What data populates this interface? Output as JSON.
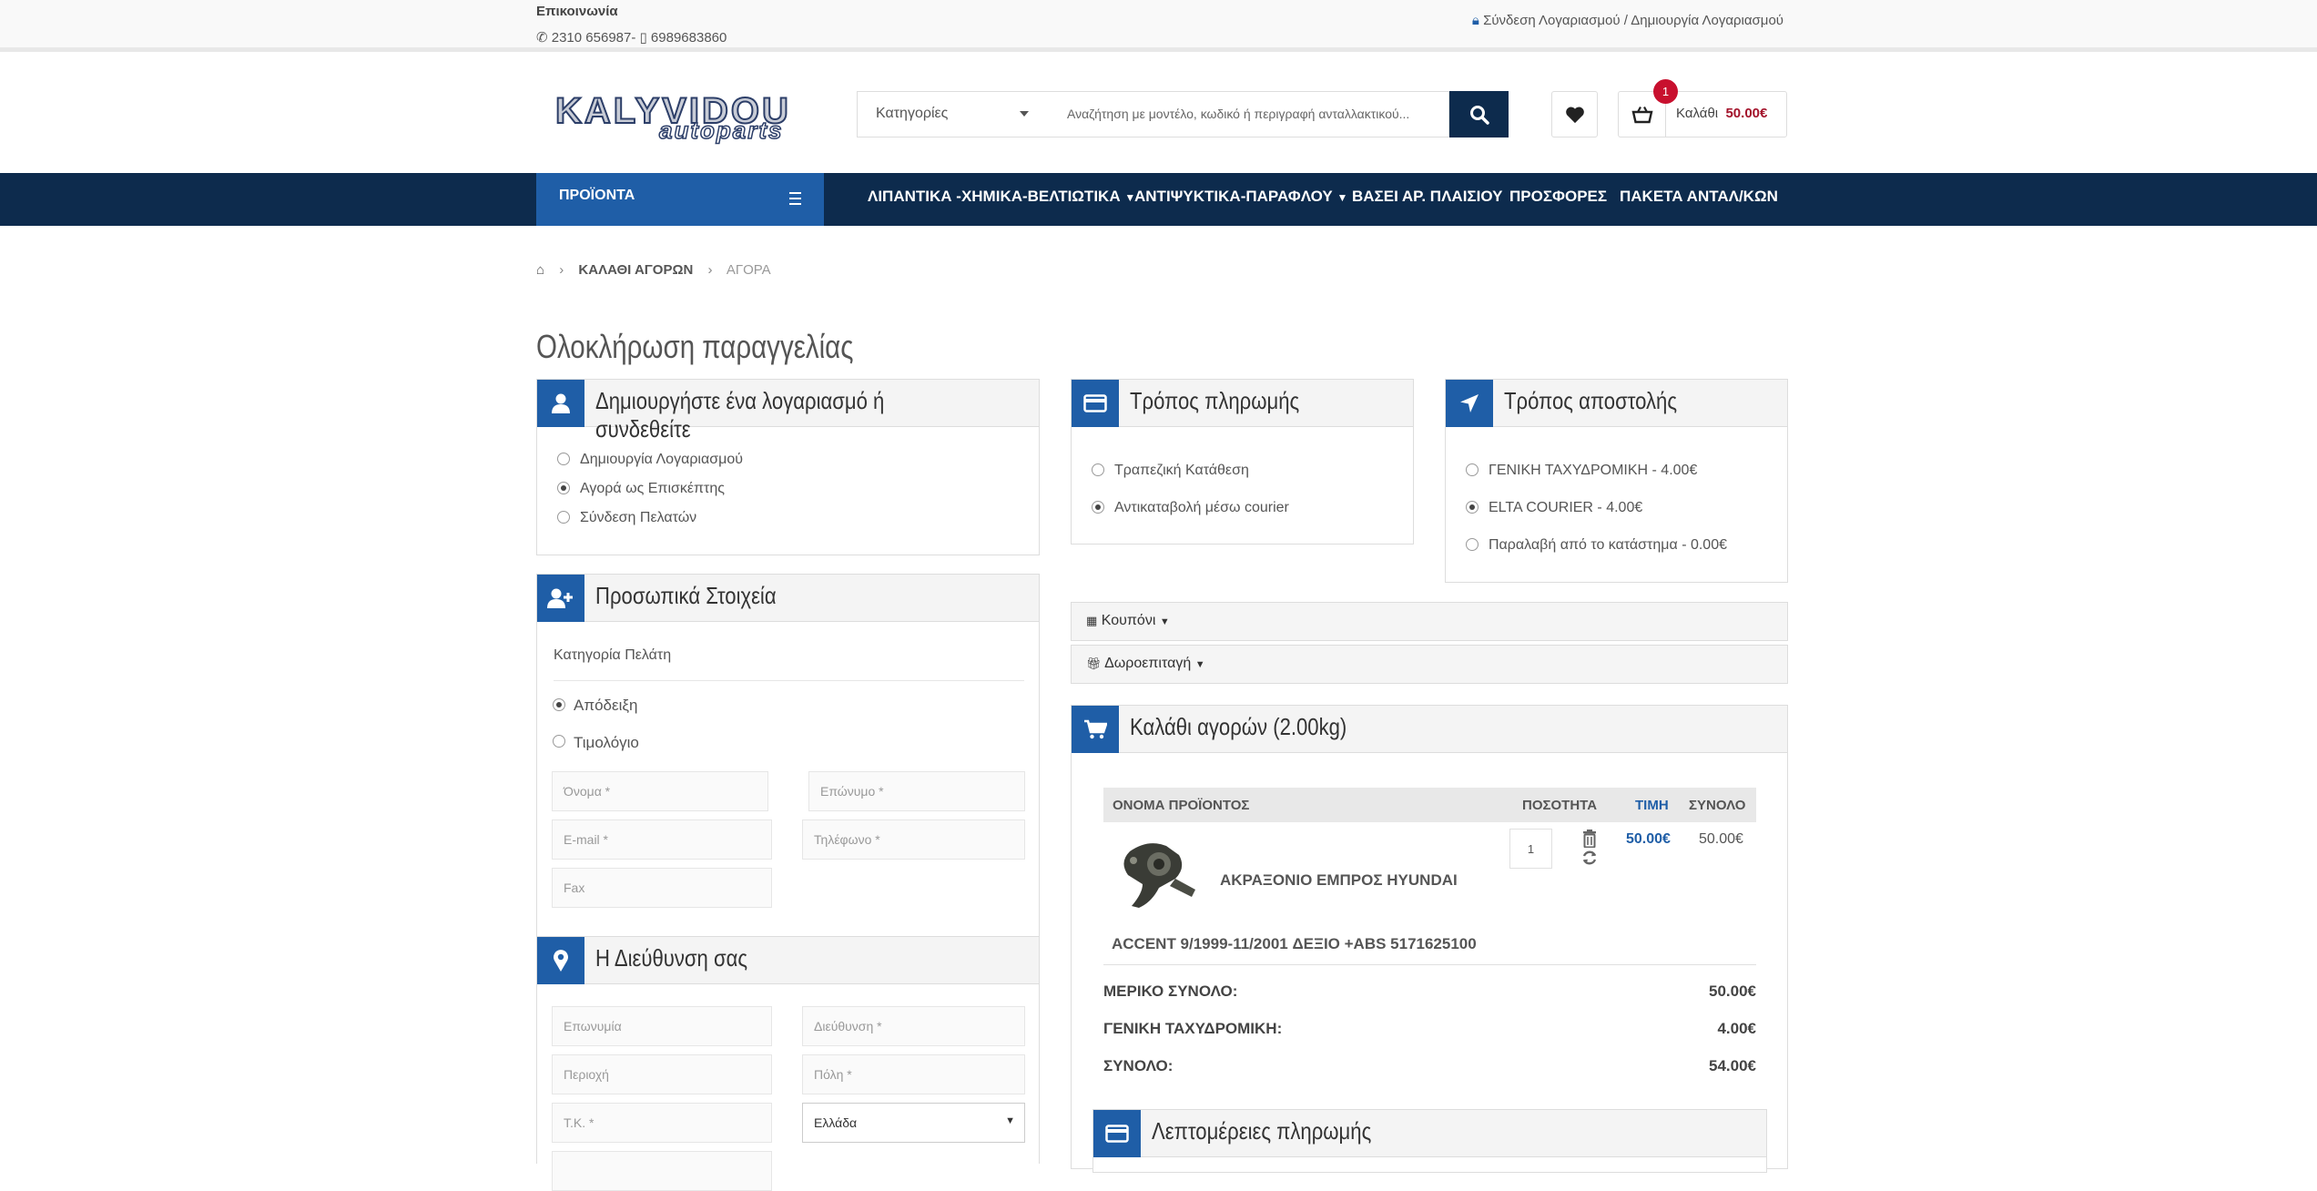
{
  "topbar": {
    "contact_title": "Επικοινωνία",
    "phones": "2310 656987- ▯ 6989683860",
    "login": "Σύνδεση Λογαριασμού",
    "separator": "/",
    "register": "Δημιουργία Λογαριασμού"
  },
  "header": {
    "logo_main": "KALYVIDOU",
    "logo_sub": "autoparts",
    "category_select": "Κατηγορίες",
    "search_placeholder": "Αναζήτηση με μοντέλο, κωδικό ή περιγραφή ανταλλακτικού...",
    "cart_count": "1",
    "cart_label": "Καλάθι",
    "cart_total": "50.00€"
  },
  "nav": {
    "products": "ΠΡΟΪΟΝΤΑ",
    "items": [
      "ΛΙΠΑΝΤΙΚΑ -ΧΗΜΙΚΑ-ΒΕΛΤΙΩΤΙΚΑ",
      "ΑΝΤΙΨΥΚΤΙΚΑ-ΠΑΡΑΦΛΟΥ",
      "ΒΑΣΕΙ ΑΡ. ΠΛΑΙΣΙΟΥ",
      "ΠΡΟΣΦΟΡΕΣ",
      "ΠΑΚΕΤΑ ΑΝΤΑΛ/ΚΩΝ"
    ]
  },
  "breadcrumb": {
    "cart": "ΚΑΛΑΘΙ ΑΓΟΡΩΝ",
    "current": "ΑΓΟΡΑ"
  },
  "page_title": "Ολοκλήρωση παραγγελίας",
  "account": {
    "title": "Δημιουργήστε ένα λογαριασμό ή συνδεθείτε",
    "options": [
      "Δημιουργία Λογαριασμού",
      "Αγορά ως Επισκέπτης",
      "Σύνδεση Πελατών"
    ],
    "selected": 1
  },
  "personal": {
    "title": "Προσωπικά Στοιχεία",
    "customer_category": "Κατηγορία Πελάτη",
    "options": [
      "Απόδειξη",
      "Τιμολόγιο"
    ],
    "first_name": "Όνομα *",
    "last_name": "Επώνυμο *",
    "email": "E-mail *",
    "phone": "Τηλέφωνο *",
    "fax": "Fax"
  },
  "address": {
    "title": "Η Διεύθυνση σας",
    "company": "Επωνυμία",
    "street": "Διεύθυνση *",
    "area": "Περιοχή",
    "city": "Πόλη *",
    "zip": "Τ.Κ. *",
    "country": "Ελλάδα"
  },
  "payment": {
    "title": "Τρόπος πληρωμής",
    "options": [
      "Τραπεζική Κατάθεση",
      "Αντικαταβολή μέσω courier"
    ],
    "selected": 1
  },
  "shipping": {
    "title": "Τρόπος αποστολής",
    "options": [
      "ΓΕΝΙΚΗ ΤΑΧΥΔΡΟΜΙΚΗ - 4.00€",
      "ELTA COURIER - 4.00€",
      "Παραλαβή από το κατάστημα - 0.00€"
    ],
    "selected": 1
  },
  "coupon": "Κουπόνι",
  "voucher": "Δωροεπιταγή",
  "cart": {
    "title": "Καλάθι αγορών (2.00kg)",
    "headers": {
      "name": "ΟΝΟΜΑ ΠΡΟΪΟΝΤΟΣ",
      "qty": "ΠΟΣΟΤΗΤΑ",
      "price": "ΤΙΜΗ",
      "total": "ΣΥΝΟΛΟ"
    },
    "item": {
      "name1": "ΑΚΡΑΞΟΝΙΟ ΕΜΠΡΟΣ HYUNDAI",
      "name2": "ACCENT 9/1999-11/2001 ΔΕΞΙΟ +ABS 5171625100",
      "qty": "1",
      "price": "50.00€",
      "total": "50.00€"
    },
    "subtotal_label": "ΜΕΡΙΚΟ ΣΥΝΟΛΟ:",
    "subtotal": "50.00€",
    "shipping_label": "ΓΕΝΙΚΗ ΤΑΧΥΔΡΟΜΙΚΗ:",
    "shipping": "4.00€",
    "total_label": "ΣΥΝΟΛΟ:",
    "total": "54.00€"
  },
  "payment_details": {
    "title": "Λεπτομέρειες πληρωμής"
  },
  "colors": {
    "navy": "#0d2b4d",
    "blue": "#1f5ea7",
    "red": "#c8102e"
  }
}
